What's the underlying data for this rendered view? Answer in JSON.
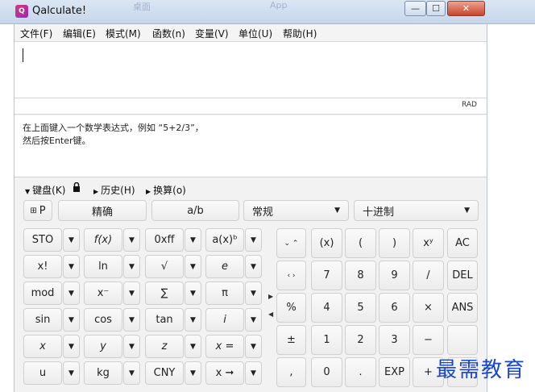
{
  "window": {
    "title": "Qalculate!",
    "app_icon": "calculator-icon",
    "min_glyph": "—",
    "max_glyph": "☐",
    "close_glyph": "✕",
    "bg_tab_1": "桌面",
    "bg_tab_2": "App"
  },
  "menu": [
    "文件(F)",
    "编辑(E)",
    "模式(M)",
    "函数(n)",
    "变量(V)",
    "单位(U)",
    "帮助(H)"
  ],
  "expression": {
    "value": ""
  },
  "status": {
    "angle_mode": "RAD"
  },
  "result": {
    "line1": "在上面键入一个数学表达式，例如 “5+2/3”，",
    "line2": "然后按Enter键。"
  },
  "tabs": {
    "keypad": "键盘(K)",
    "history": "历史(H)",
    "conversion": "换算(o)"
  },
  "top_row": {
    "p_button": "P",
    "exact": "精确",
    "fraction": "a/b",
    "format_select": "常规",
    "base_select": "十进制"
  },
  "left_keys": [
    [
      "STO",
      "f(x)",
      "0xff",
      "a(x)ᵇ"
    ],
    [
      "x!",
      "ln",
      "√",
      "e"
    ],
    [
      "mod",
      "x⁻",
      "∑",
      "π"
    ],
    [
      "sin",
      "cos",
      "tan",
      "i"
    ],
    [
      "x",
      "y",
      "z",
      "x ="
    ],
    [
      "u",
      "kg",
      "CNY",
      "x ➞"
    ]
  ],
  "right_keys": [
    [
      "(x)",
      "(",
      ")",
      "xʸ",
      "AC"
    ],
    [
      "7",
      "8",
      "9",
      "/",
      "DEL"
    ],
    [
      "4",
      "5",
      "6",
      "×",
      "ANS"
    ],
    [
      "1",
      "2",
      "3",
      "−",
      ""
    ],
    [
      "0",
      ".",
      "EXP",
      "+",
      ""
    ]
  ],
  "nav_keys": {
    "updown": "⌄ ⌃",
    "leftright": "‹ ›",
    "percent": "%",
    "plusminus": "±",
    "comma": ","
  },
  "watermark": "最需教育"
}
